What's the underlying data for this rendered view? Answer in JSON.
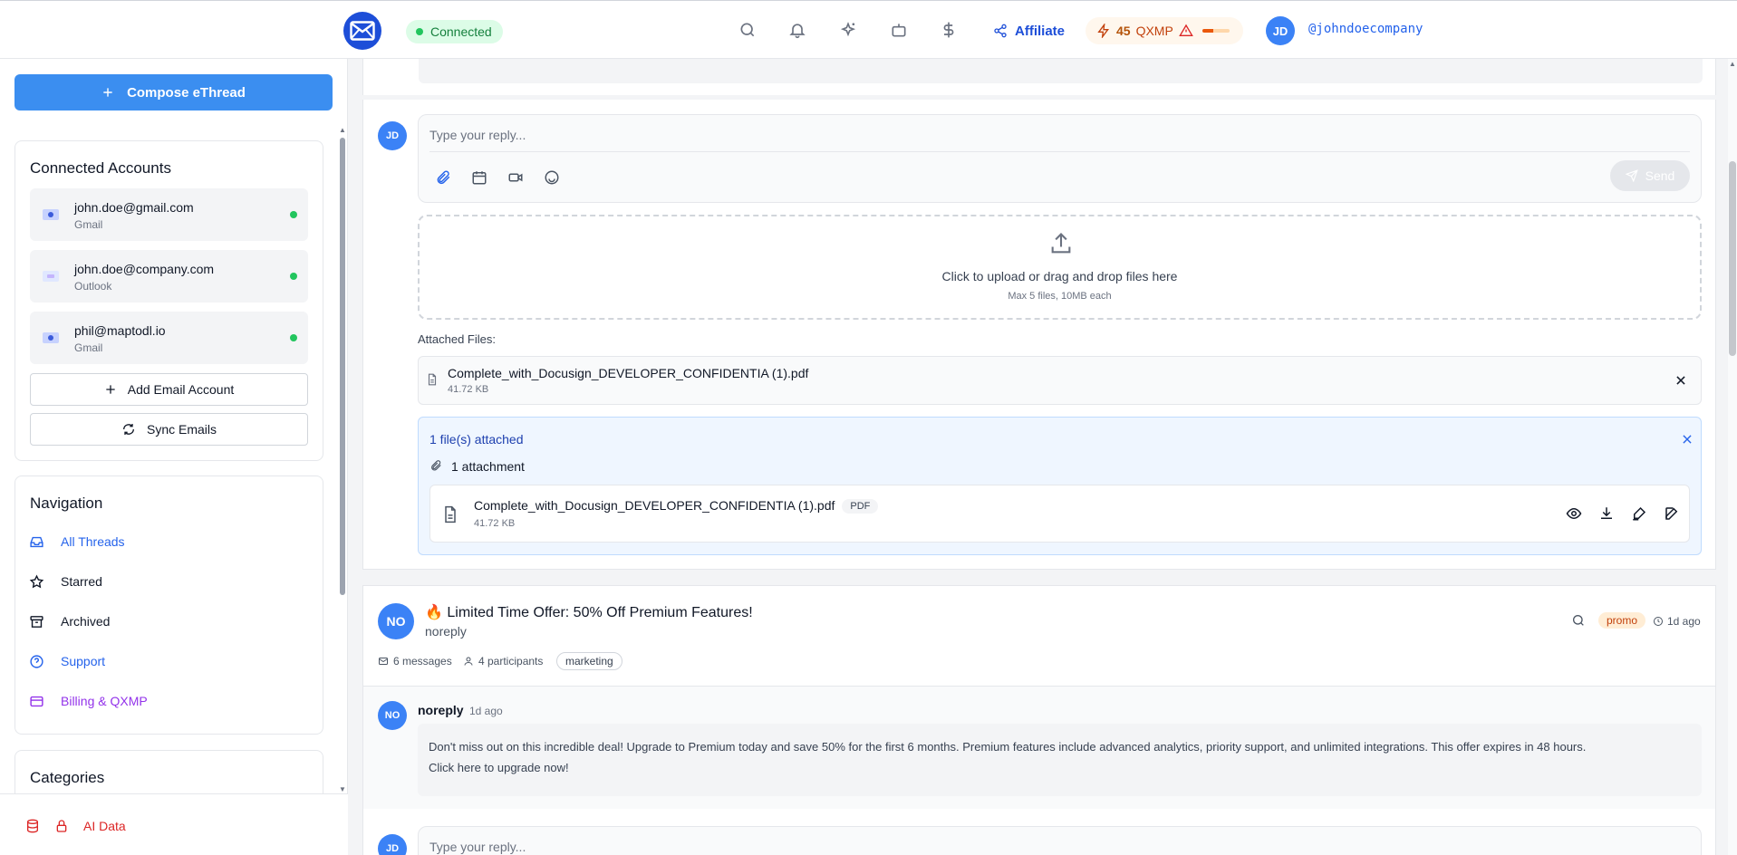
{
  "header": {
    "connection_status": "Connected",
    "affiliate_label": "Affiliate",
    "qxmp_count": "45",
    "qxmp_unit": "QXMP",
    "qxmp_fraction": 0.4,
    "avatar_initials": "JD",
    "username": "@johndoecompany"
  },
  "sidebar": {
    "compose_label": "Compose eThread",
    "accounts_title": "Connected Accounts",
    "accounts": [
      {
        "email": "john.doe@gmail.com",
        "provider": "Gmail"
      },
      {
        "email": "john.doe@company.com",
        "provider": "Outlook"
      },
      {
        "email": "phil@maptodl.io",
        "provider": "Gmail"
      }
    ],
    "add_account_label": "Add Email Account",
    "sync_label": "Sync Emails",
    "navigation_title": "Navigation",
    "nav": [
      {
        "label": "All Threads",
        "color": "#2563eb"
      },
      {
        "label": "Starred",
        "color": "#111827"
      },
      {
        "label": "Archived",
        "color": "#111827"
      },
      {
        "label": "Support",
        "color": "#2563eb"
      },
      {
        "label": "Billing & QXMP",
        "color": "#9333ea"
      }
    ],
    "categories_title": "Categories",
    "ai_data_label": "AI Data"
  },
  "reply": {
    "avatar_initials": "JD",
    "placeholder": "Type your reply...",
    "send_label": "Send"
  },
  "upload": {
    "title": "Click to upload or drag and drop files here",
    "hint": "Max 5 files, 10MB each"
  },
  "attached": {
    "heading": "Attached Files:",
    "file_name": "Complete_with_Docusign_DEVELOPER_CONFIDENTIA (1).pdf",
    "file_size": "41.72 KB",
    "summary": "1 file(s) attached",
    "count_label": "1 attachment",
    "file_type": "PDF"
  },
  "thread": {
    "avatar_initials": "NO",
    "emoji": "🔥",
    "subject": "Limited Time Offer: 50% Off Premium Features!",
    "sender": "noreply",
    "tag": "promo",
    "time": "1d ago",
    "messages": "6 messages",
    "participants": "4 participants",
    "category": "marketing"
  },
  "message": {
    "avatar_initials": "NO",
    "sender": "noreply",
    "time": "1d ago",
    "body_line1": "Don't miss out on this incredible deal! Upgrade to Premium today and save 50% for the first 6 months. Premium features include advanced analytics, priority support, and unlimited integrations. This offer expires in 48 hours.",
    "body_line2": "Click here to upgrade now!"
  },
  "reply2": {
    "avatar_initials": "JD",
    "placeholder": "Type your reply..."
  }
}
